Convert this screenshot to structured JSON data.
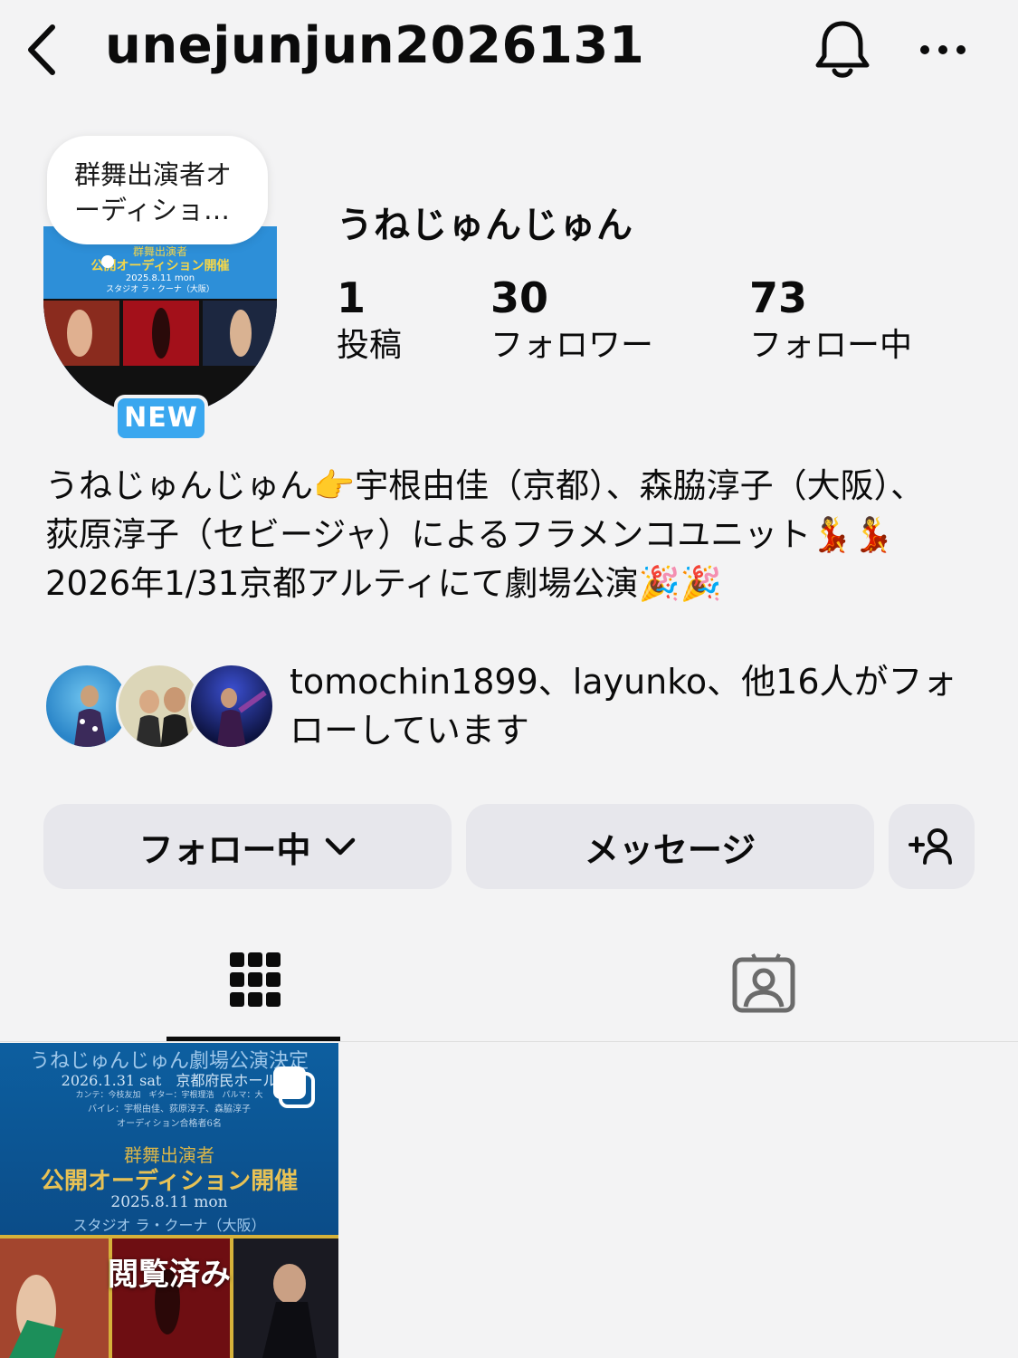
{
  "header": {
    "username": "unejunjun2026131",
    "back_icon": "chevron-left-icon",
    "bell_icon": "bell-icon",
    "more_icon": "more-horizontal-icon"
  },
  "profile": {
    "note": "群舞出演者オーディショ…",
    "new_badge": "NEW",
    "display_name": "うねじゅんじゅん",
    "avatar_text": {
      "line1": "群舞出演者",
      "line2": "公開オーディション開催",
      "line3": "2025.8.11 mon",
      "line4": "スタジオ ラ・クーナ（大阪）"
    }
  },
  "stats": [
    {
      "value": "1",
      "label": "投稿"
    },
    {
      "value": "30",
      "label": "フォロワー"
    },
    {
      "value": "73",
      "label": "フォロー中"
    }
  ],
  "bio": "うねじゅんじゅん👉宇根由佳（京都）、森脇淳子（大阪）、\n荻原淳子（セビージャ）によるフラメンコユニット💃💃\n2026年1/31京都アルティにて劇場公演🎉🎉",
  "mutuals": {
    "text": "tomochin1899、layunko、他16人がフォローしています"
  },
  "buttons": {
    "following": "フォロー中",
    "message": "メッセージ",
    "add_person_icon": "add-person-icon"
  },
  "tabs": {
    "grid_icon": "grid-icon",
    "tagged_icon": "tagged-person-icon"
  },
  "post": {
    "line1": "うねじゅんじゅん劇場公演決定",
    "line2": "2026.1.31 sat　京都府民ホール",
    "line3": "カンテ：今枝友加　ギター：宇根理浩　パルマ：大",
    "line4": "バイレ：宇根由佳、荻原淳子、森脇淳子",
    "line5": "オーディション合格者6名",
    "line6": "群舞出演者",
    "line7": "公開オーディション開催",
    "line8": "2025.8.11 mon",
    "line9": "スタジオ ラ・クーナ（大阪）",
    "viewed": "閲覧済み"
  },
  "colors": {
    "background": "#f3f3f4",
    "button_bg": "#e7e7ec",
    "badge_blue": "#3aa7ef"
  }
}
